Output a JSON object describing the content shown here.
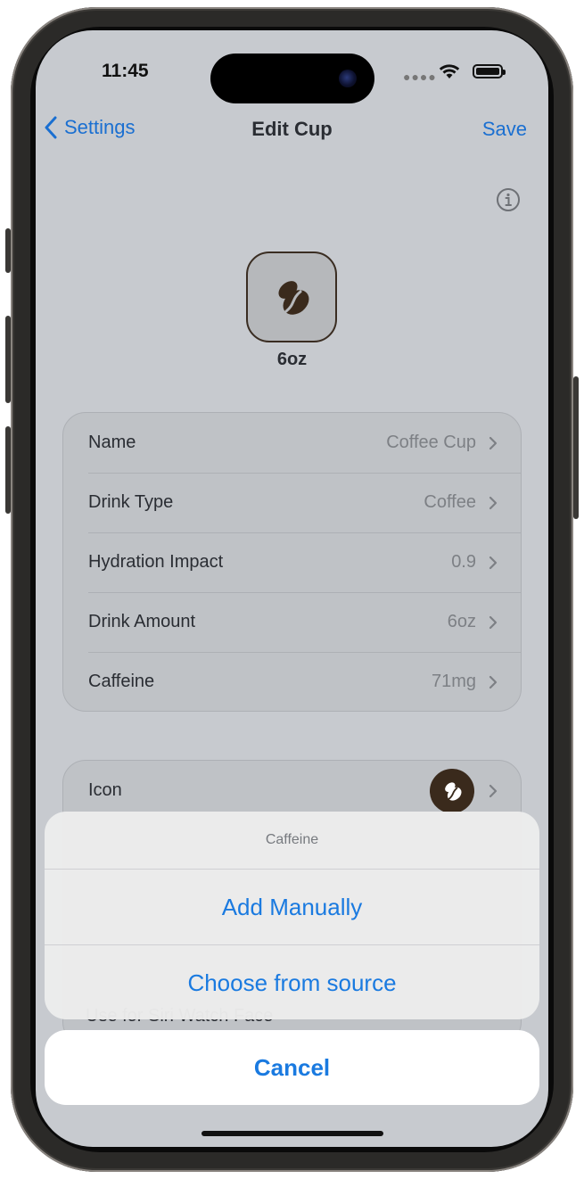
{
  "status_bar": {
    "time": "11:45"
  },
  "nav": {
    "back_label": "Settings",
    "title": "Edit Cup",
    "save_label": "Save"
  },
  "cup": {
    "size_label": "6oz",
    "icon": "coffee-bean-icon"
  },
  "details": [
    {
      "label": "Name",
      "value": "Coffee Cup"
    },
    {
      "label": "Drink Type",
      "value": "Coffee"
    },
    {
      "label": "Hydration Impact",
      "value": "0.9"
    },
    {
      "label": "Drink Amount",
      "value": "6oz"
    },
    {
      "label": "Caffeine",
      "value": "71mg"
    }
  ],
  "appearance": {
    "icon_label": "Icon",
    "watch_face_label": "Use for Siri Watch Face"
  },
  "action_sheet": {
    "title": "Caffeine",
    "options": [
      "Add Manually",
      "Choose from source"
    ],
    "cancel_label": "Cancel"
  },
  "colors": {
    "accent": "#1a7ae0",
    "background": "#c7cacf",
    "icon_brown": "#3a2a1c"
  }
}
